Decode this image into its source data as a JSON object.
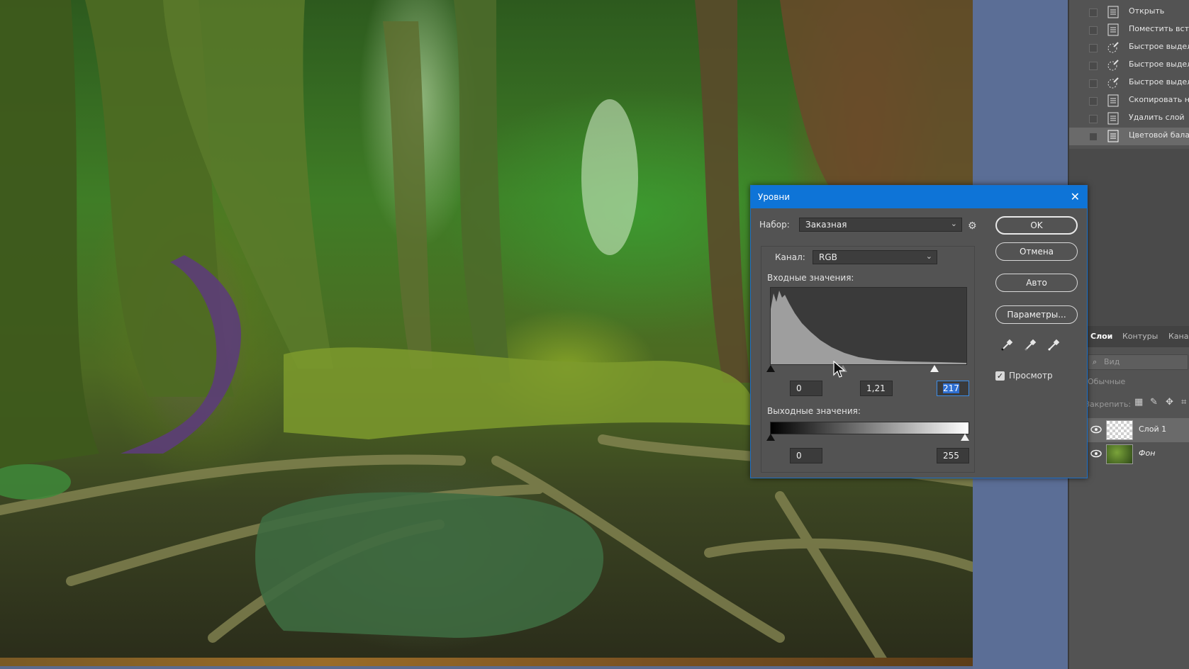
{
  "history": {
    "items": [
      {
        "label": "Открыть",
        "icon": "document-icon"
      },
      {
        "label": "Поместить встро",
        "icon": "document-icon"
      },
      {
        "label": "Быстрое выделен",
        "icon": "quick-selection-icon"
      },
      {
        "label": "Быстрое выделен",
        "icon": "quick-selection-icon"
      },
      {
        "label": "Быстрое выделен",
        "icon": "quick-selection-icon"
      },
      {
        "label": "Скопировать на н",
        "icon": "document-icon"
      },
      {
        "label": "Удалить слой",
        "icon": "document-icon"
      },
      {
        "label": "Цветовой баланс",
        "icon": "document-icon",
        "selected": true
      }
    ]
  },
  "layers_panel": {
    "tabs": [
      "Слои",
      "Контуры",
      "Канал"
    ],
    "active_tab": "Слои",
    "search_placeholder": "Вид",
    "blend_mode": "Обычные",
    "lock_label": "Закрепить:",
    "layers": [
      {
        "name": "Слой 1",
        "thumb": "transparent",
        "selected": true
      },
      {
        "name": "Фон",
        "thumb": "photo",
        "selected": false
      }
    ]
  },
  "levels_dialog": {
    "title": "Уровни",
    "preset_label": "Набор:",
    "preset_value": "Заказная",
    "channel_label": "Канал:",
    "channel_value": "RGB",
    "input_label": "Входные значения:",
    "input_black": "0",
    "input_gamma": "1,21",
    "input_white": "217",
    "output_label": "Выходные значения:",
    "output_black": "0",
    "output_white": "255",
    "buttons": {
      "ok": "OK",
      "cancel": "Отмена",
      "auto": "Авто",
      "options": "Параметры..."
    },
    "preview_label": "Просмотр",
    "preview_checked": true,
    "colors": {
      "titlebar": "#0e74d7",
      "panel": "#535353",
      "selection": "#2f6fd1"
    }
  }
}
